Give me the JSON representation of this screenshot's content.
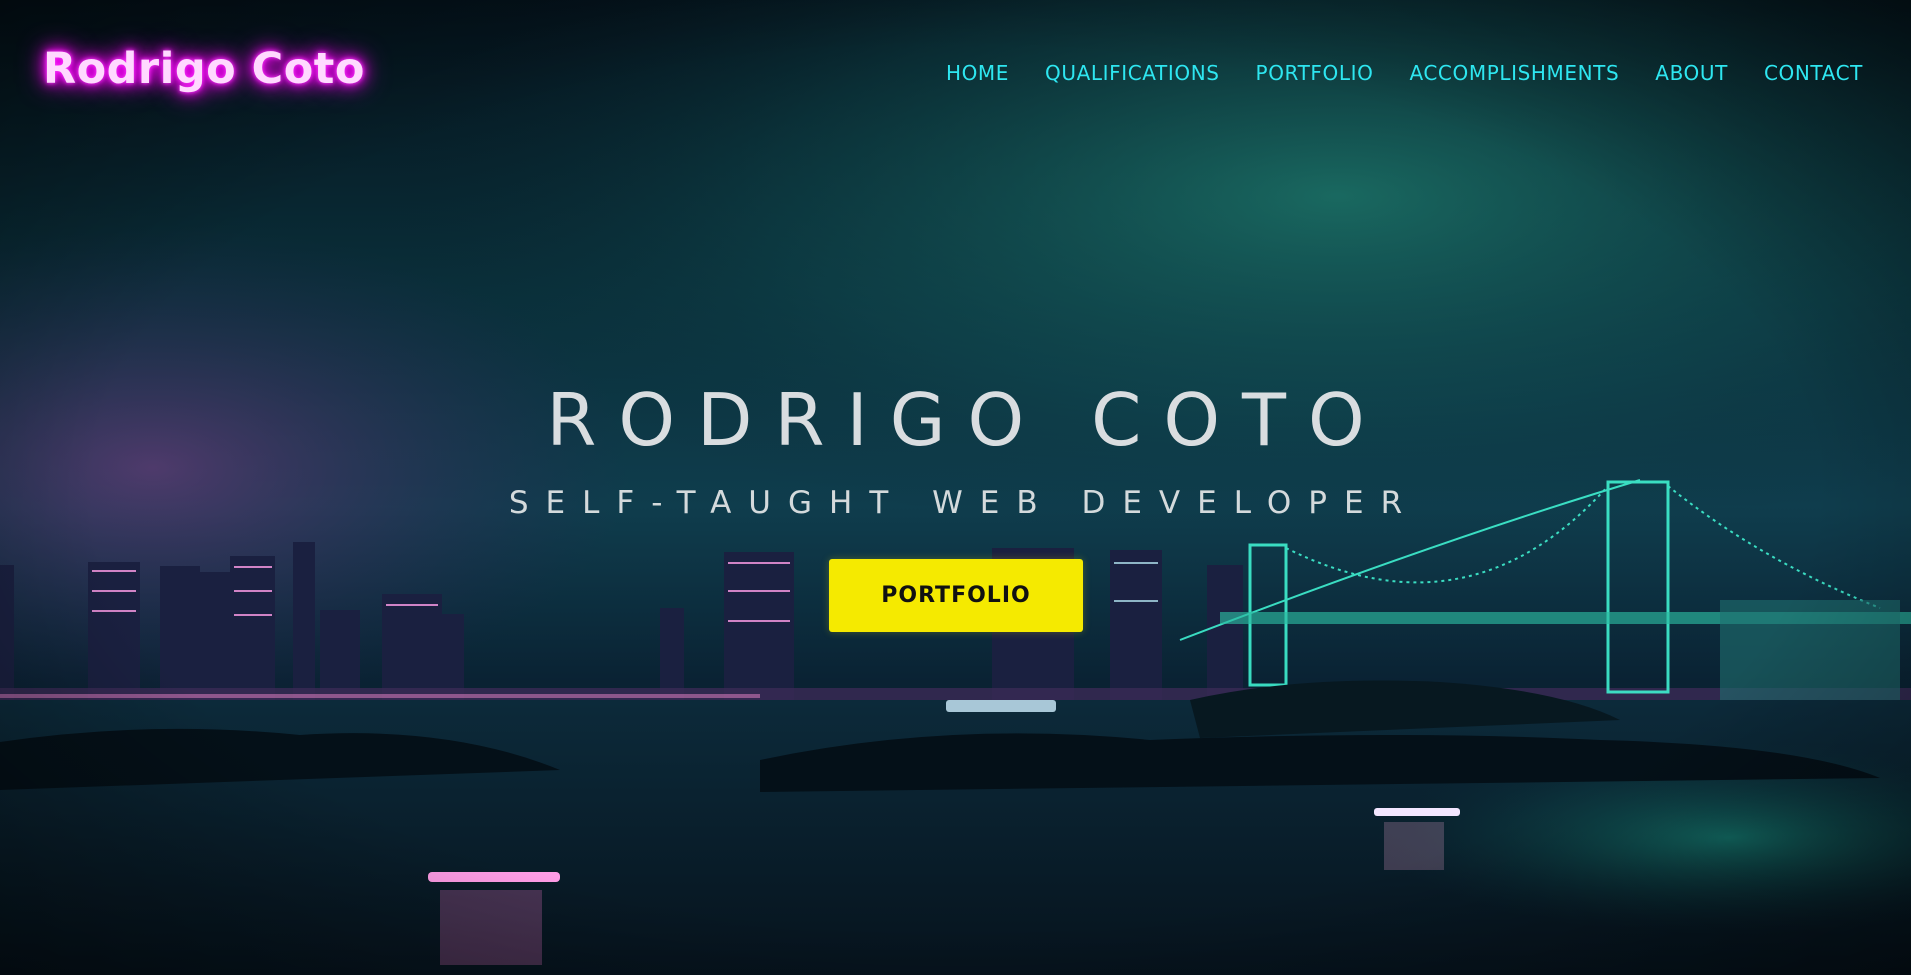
{
  "header": {
    "logo": "Rodrigo Coto",
    "nav": [
      "HOME",
      "QUALIFICATIONS",
      "PORTFOLIO",
      "ACCOMPLISHMENTS",
      "ABOUT",
      "CONTACT"
    ]
  },
  "hero": {
    "title": "RODRIGO COTO",
    "subtitle": "SELF-TAUGHT WEB DEVELOPER",
    "cta_label": "PORTFOLIO",
    "background_image": "night-city-skyline-bridge"
  },
  "colors": {
    "logo_glow": "#ff00ff",
    "nav_text": "#2ee6f0",
    "cta_bg": "#f5ea00",
    "hero_text": "#d9dde0"
  }
}
